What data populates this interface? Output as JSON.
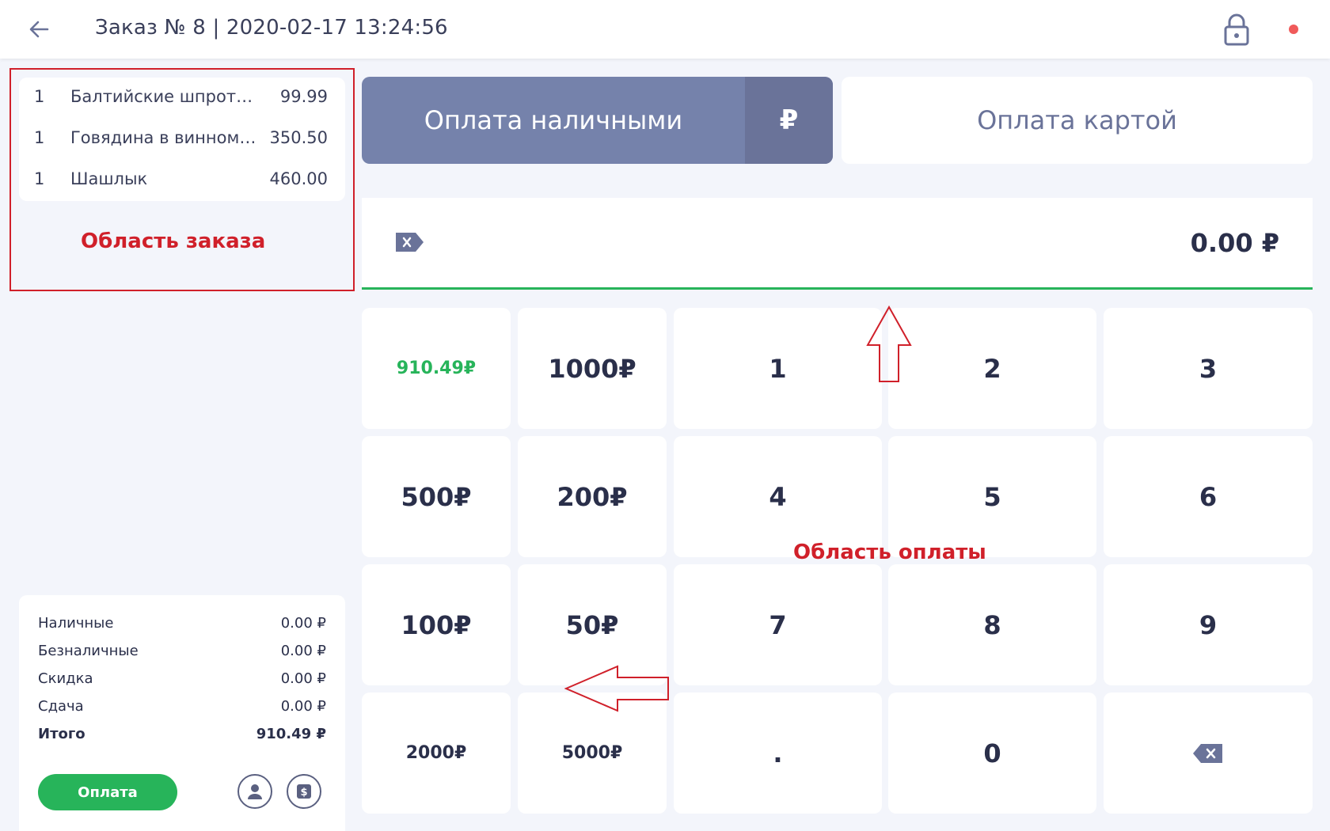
{
  "header": {
    "title": "Заказ № 8 | 2020-02-17 13:24:56",
    "back_icon": "arrow-left-icon",
    "lock_icon": "lock-icon",
    "status_color": "#f05a5a"
  },
  "order": {
    "items": [
      {
        "qty": "1",
        "name": "Балтийские шпроты с ...",
        "price": "99.99"
      },
      {
        "qty": "1",
        "name": "Говядина в винном с...",
        "price": "350.50"
      },
      {
        "qty": "1",
        "name": "Шашлык",
        "price": "460.00"
      }
    ],
    "annotation": "Область заказа"
  },
  "summary": {
    "rows": [
      {
        "label": "Наличные",
        "value": "0.00 ₽"
      },
      {
        "label": "Безналичные",
        "value": "0.00 ₽"
      },
      {
        "label": "Скидка",
        "value": "0.00 ₽"
      },
      {
        "label": "Сдача",
        "value": "0.00 ₽"
      },
      {
        "label": "Итого",
        "value": "910.49 ₽"
      }
    ],
    "pay_label": "Оплата",
    "pay_color": "#27b45a"
  },
  "payment": {
    "cash_label": "Оплата наличными",
    "cash_currency": "₽",
    "card_label": "Оплата картой",
    "amount": "0.00 ₽",
    "annotation": "Область оплаты",
    "accent_color": "#7582ab"
  },
  "keypad": {
    "quick": [
      "910.49₽",
      "1000₽",
      "500₽",
      "200₽",
      "100₽",
      "50₽",
      "2000₽",
      "5000₽"
    ],
    "digits": [
      "1",
      "2",
      "3",
      "4",
      "5",
      "6",
      "7",
      "8",
      "9",
      ".",
      "0"
    ]
  }
}
